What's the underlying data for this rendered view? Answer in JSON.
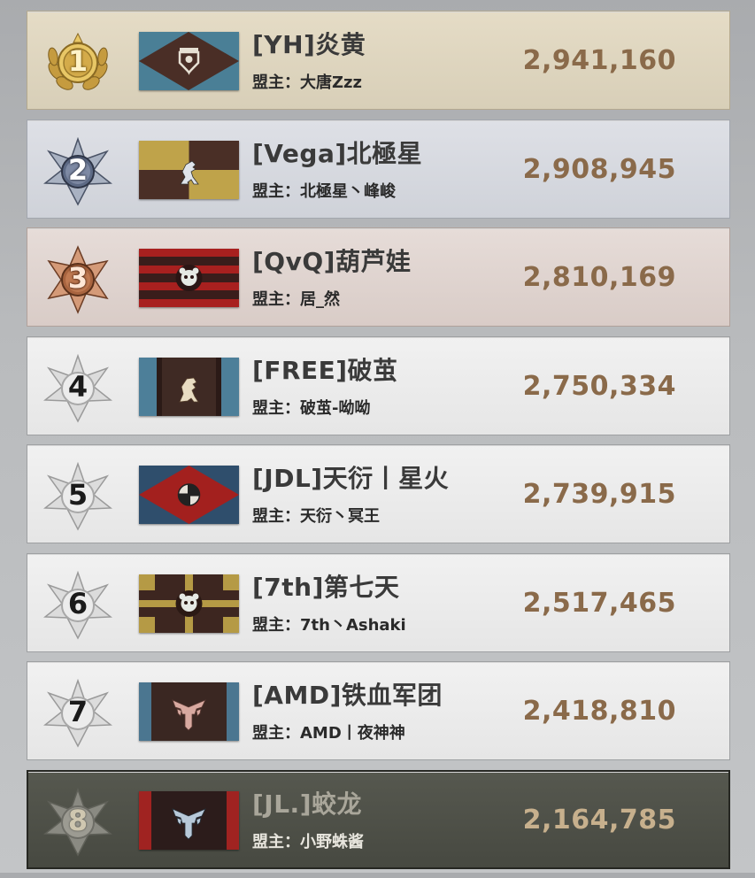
{
  "leader_prefix": "盟主：",
  "rows": [
    {
      "rank": "1",
      "name": "[YH]炎黄",
      "leader": "大唐Zzz",
      "score": "2,941,160"
    },
    {
      "rank": "2",
      "name": "[Vega]北極星",
      "leader": "北極星丶峰峻",
      "score": "2,908,945"
    },
    {
      "rank": "3",
      "name": "[QvQ]葫芦娃",
      "leader": "居_然",
      "score": "2,810,169"
    },
    {
      "rank": "4",
      "name": "[FREE]破茧",
      "leader": "破茧-呦呦",
      "score": "2,750,334"
    },
    {
      "rank": "5",
      "name": "[JDL]天衍丨星火",
      "leader": "天衍丶冥王",
      "score": "2,739,915"
    },
    {
      "rank": "6",
      "name": "[7th]第七天",
      "leader": "7th丶Ashaki",
      "score": "2,517,465"
    },
    {
      "rank": "7",
      "name": "[AMD]铁血军团",
      "leader": "AMD丨夜神神",
      "score": "2,418,810"
    },
    {
      "rank": "8",
      "name": "[JL.]蛟龙",
      "leader": "小野蛛酱",
      "score": "2,164,785"
    }
  ],
  "colors": {
    "gold": "#c9a24a",
    "silver": "#9aa3b3",
    "bronze": "#b87a5a",
    "score": "#8a6a4a",
    "highlight_row": "#4f5149"
  },
  "icons": {
    "badges": [
      "gold-laurel-rank-badge",
      "silver-star-rank-badge",
      "bronze-star-rank-badge",
      "gray-star-rank-badge"
    ],
    "flags": [
      "crown-shield-emblem",
      "rampant-lion-emblem",
      "panda-emblem",
      "lion-emblem",
      "sun-cross-emblem",
      "panda-emblem",
      "eagle-wings-emblem",
      "eagle-wings-emblem"
    ]
  }
}
